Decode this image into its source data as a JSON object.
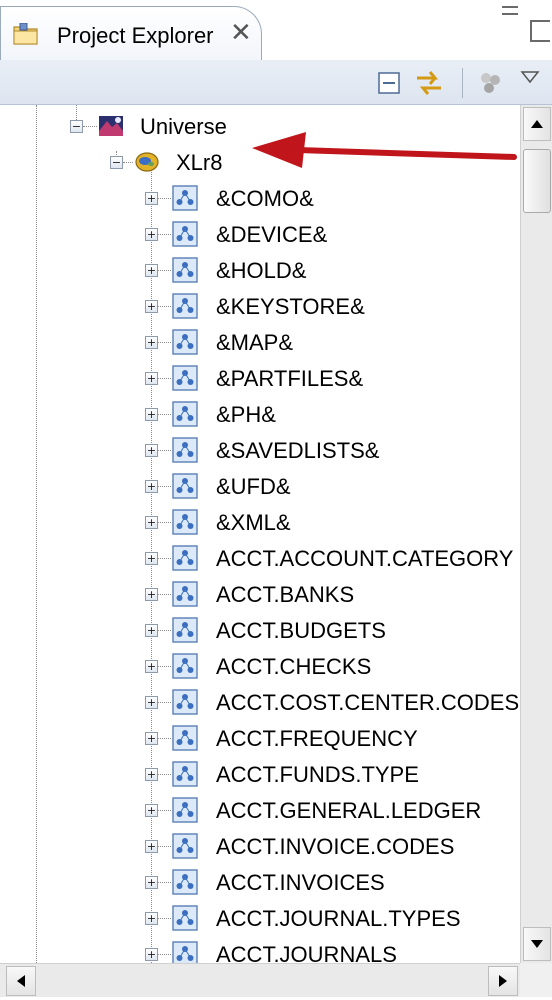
{
  "tab": {
    "title": "Project Explorer",
    "close_glyph": "✕",
    "folder_icon": "project-folder-icon"
  },
  "toolbar": {
    "buttons": [
      "collapse-all-icon",
      "link-with-editor-icon",
      "filter-icon",
      "view-menu-icon"
    ]
  },
  "tree": {
    "root": {
      "label": "Universe",
      "icon": "universe-icon",
      "expanded": true
    },
    "account": {
      "label": "XLr8",
      "icon": "database-icon",
      "expanded": true
    },
    "files": [
      "&COMO&",
      "&DEVICE&",
      "&HOLD&",
      "&KEYSTORE&",
      "&MAP&",
      "&PARTFILES&",
      "&PH&",
      "&SAVEDLISTS&",
      "&UFD&",
      "&XML&",
      "ACCT.ACCOUNT.CATEGORY",
      "ACCT.BANKS",
      "ACCT.BUDGETS",
      "ACCT.CHECKS",
      "ACCT.COST.CENTER.CODES",
      "ACCT.FREQUENCY",
      "ACCT.FUNDS.TYPE",
      "ACCT.GENERAL.LEDGER",
      "ACCT.INVOICE.CODES",
      "ACCT.INVOICES",
      "ACCT.JOURNAL.TYPES",
      "ACCT.JOURNALS"
    ]
  },
  "colors": {
    "annotation_arrow": "#c0161b",
    "tab_border": "#9aaabb",
    "toolbar_bg": "#dde5f0"
  }
}
